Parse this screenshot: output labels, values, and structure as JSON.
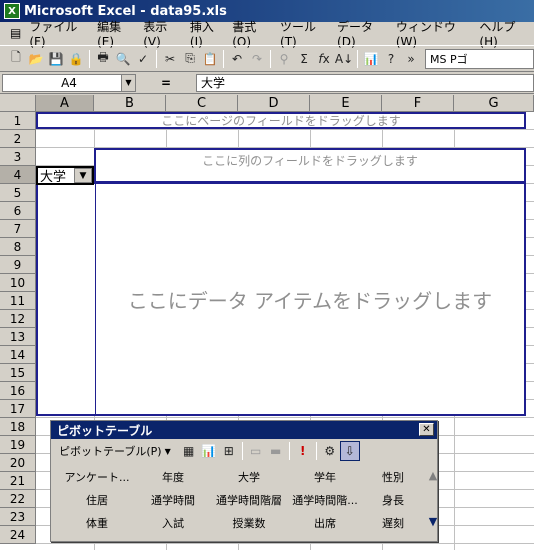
{
  "app": {
    "title": "Microsoft Excel - data95.xls",
    "icon": "excel-icon"
  },
  "menu": [
    "ファイル(F)",
    "編集(E)",
    "表示(V)",
    "挿入(I)",
    "書式(O)",
    "ツール(T)",
    "データ(D)",
    "ウィンドウ(W)",
    "ヘルプ(H)"
  ],
  "toolbar": {
    "font_name": "MS Pゴ"
  },
  "formula_bar": {
    "name_box": "A4",
    "eq": "=",
    "formula": "大学"
  },
  "columns": [
    "A",
    "B",
    "C",
    "D",
    "E",
    "F",
    "G"
  ],
  "rows": [
    "1",
    "2",
    "3",
    "4",
    "5",
    "6",
    "7",
    "8",
    "9",
    "10",
    "11",
    "12",
    "13",
    "14",
    "15",
    "16",
    "17",
    "18",
    "19",
    "20",
    "21",
    "22",
    "23",
    "24"
  ],
  "cell_a4": "大学",
  "pivot_placeholders": {
    "page": "ここにページのフィールドをドラッグします",
    "column": "ここに列のフィールドをドラッグします",
    "data": "ここにデータ アイテムをドラッグします"
  },
  "pivot_toolbar": {
    "title": "ピボットテーブル",
    "menu_label": "ピボットテーブル(P)",
    "fields": [
      "アンケート...",
      "年度",
      "大学",
      "学年",
      "性別",
      "住居",
      "通学時間",
      "通学時間階層",
      "通学時間階...",
      "身長",
      "体重",
      "入試",
      "授業数",
      "出席",
      "遅刻"
    ]
  }
}
